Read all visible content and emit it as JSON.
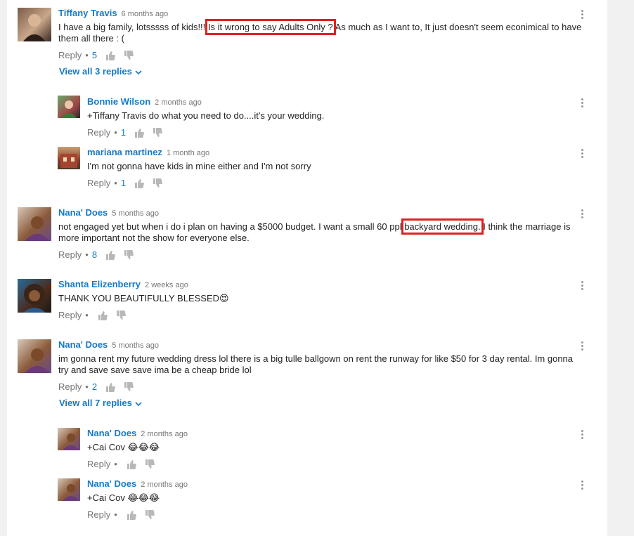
{
  "ui": {
    "reply_label": "Reply",
    "separator": "•",
    "highlight_color": "#e02020",
    "author_color": "#167ac6"
  },
  "comments": [
    {
      "author": "Tiffany Travis",
      "time": "6 months ago",
      "text_before": "I have a big family, lotsssss of kids!!! ",
      "text_highlight": "Is it wrong to say Adults Only ?",
      "text_after": " As much as I want to, It just doesn't seem econimical to have them all there : (",
      "likes": "5",
      "view_replies": "View all 3 replies",
      "replies": [
        {
          "author": "Bonnie Wilson",
          "time": "2 months ago",
          "text": "+Tiffany Travis do what you need to do....it's your wedding.",
          "likes": "1"
        },
        {
          "author": "mariana martinez",
          "time": "1 month ago",
          "text": "I'm not gonna have kids in mine either and I'm not sorry",
          "likes": "1"
        }
      ]
    },
    {
      "author": "Nana' Does",
      "time": "5 months ago",
      "text_before": "not engaged yet but when i do i plan on having a $5000 budget. I want a small 60 ppl ",
      "text_highlight": "backyard wedding.",
      "text_after": " I think the marriage is more important not the show for everyone else.",
      "likes": "8"
    },
    {
      "author": "Shanta Elizenberry",
      "time": "2 weeks ago",
      "text": "THANK YOU BEAUTIFULLY BLESSED😍",
      "likes": ""
    },
    {
      "author": "Nana' Does",
      "time": "5 months ago",
      "text": "im gonna rent my future wedding dress lol there is a big tulle ballgown on rent the runway for like $50 for 3 day rental. Im gonna try and save save save ima be a cheap bride lol",
      "likes": "2",
      "view_replies": "View all 7 replies",
      "replies": [
        {
          "author": "Nana' Does",
          "time": "2 months ago",
          "text": "+Cai Cov 😂😂😂",
          "likes": ""
        },
        {
          "author": "Nana' Does",
          "time": "2 months ago",
          "text": "+Cai Cov 😂😂😂",
          "likes": ""
        }
      ]
    }
  ]
}
